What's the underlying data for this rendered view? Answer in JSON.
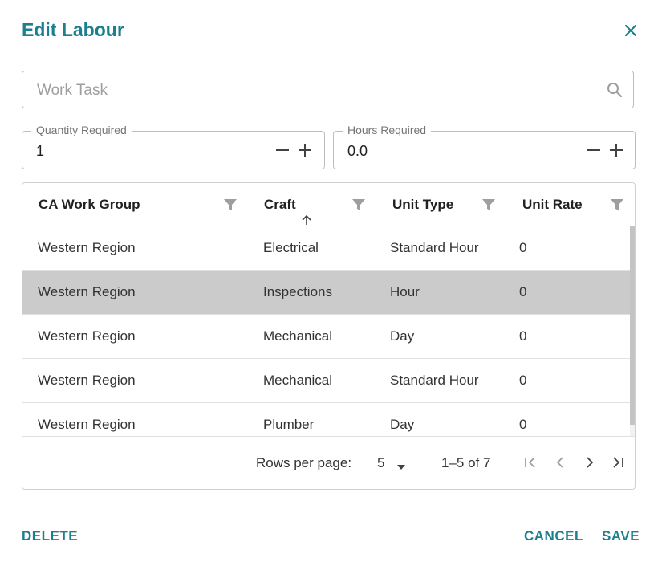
{
  "dialog": {
    "title": "Edit Labour",
    "close_icon": "close-icon"
  },
  "search": {
    "placeholder": "Work Task",
    "value": "",
    "icon": "search-icon"
  },
  "quantity": {
    "label": "Quantity Required",
    "value": "1"
  },
  "hours": {
    "label": "Hours Required",
    "value": "0.0"
  },
  "table": {
    "columns": [
      {
        "label": "CA Work Group"
      },
      {
        "label": "Craft",
        "sort": "ascending"
      },
      {
        "label": "Unit Type"
      },
      {
        "label": "Unit Rate"
      }
    ],
    "rows": [
      {
        "group": "Western Region",
        "craft": "Electrical",
        "unit_type": "Standard Hour",
        "unit_rate": "0",
        "selected": false
      },
      {
        "group": "Western Region",
        "craft": "Inspections",
        "unit_type": "Hour",
        "unit_rate": "0",
        "selected": true
      },
      {
        "group": "Western Region",
        "craft": "Mechanical",
        "unit_type": "Day",
        "unit_rate": "0",
        "selected": false
      },
      {
        "group": "Western Region",
        "craft": "Mechanical",
        "unit_type": "Standard Hour",
        "unit_rate": "0",
        "selected": false
      },
      {
        "group": "Western Region",
        "craft": "Plumber",
        "unit_type": "Day",
        "unit_rate": "0",
        "selected": false
      }
    ]
  },
  "pagination": {
    "rows_per_page_label": "Rows per page:",
    "rows_per_page": "5",
    "range": "1–5 of 7"
  },
  "actions": {
    "delete": "DELETE",
    "cancel": "CANCEL",
    "save": "SAVE"
  },
  "colors": {
    "accent": "#1c7f8f",
    "selected_row": "#cbcbcb"
  }
}
